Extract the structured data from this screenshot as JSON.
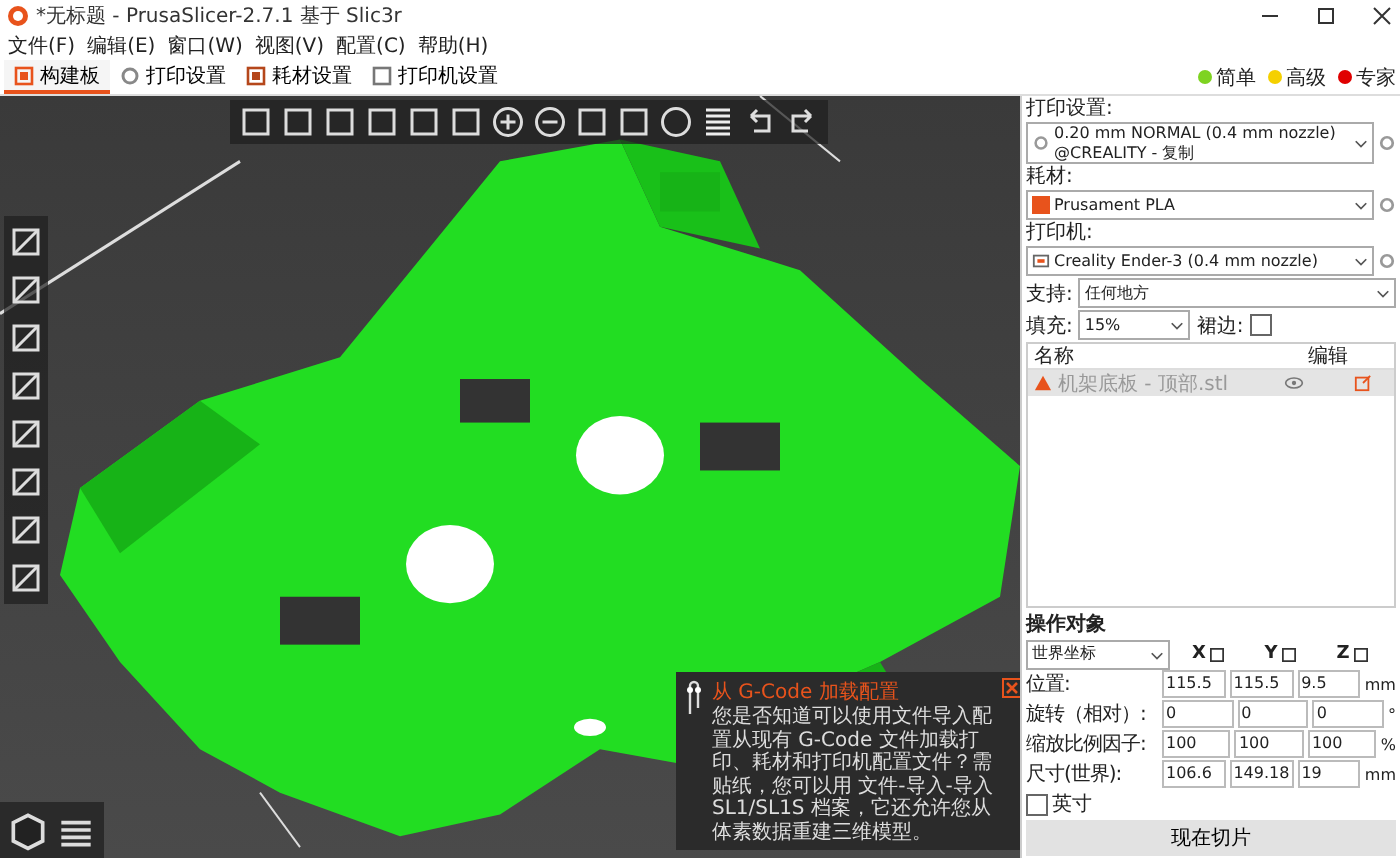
{
  "window": {
    "title": "*无标题 - PrusaSlicer-2.7.1 基于 Slic3r"
  },
  "menu": [
    "文件(F)",
    "编辑(E)",
    "窗口(W)",
    "视图(V)",
    "配置(C)",
    "帮助(H)"
  ],
  "tabs": [
    {
      "label": "构建板",
      "kind": "plater",
      "selected": true
    },
    {
      "label": "打印设置",
      "kind": "print",
      "selected": false
    },
    {
      "label": "耗材设置",
      "kind": "filament",
      "selected": false
    },
    {
      "label": "打印机设置",
      "kind": "printer",
      "selected": false
    }
  ],
  "modes": [
    {
      "label": "简单",
      "color": "#7ed321"
    },
    {
      "label": "高级",
      "color": "#f5d000"
    },
    {
      "label": "专家",
      "color": "#e00000"
    }
  ],
  "presets": [
    {
      "label": "打印设置:",
      "value": "0.20 mm NORMAL (0.4 mm nozzle) @CREALITY - 复制",
      "kind": "print"
    },
    {
      "label": "耗材:",
      "value": "Prusament PLA",
      "kind": "filament",
      "color": "#e8531c"
    },
    {
      "label": "打印机:",
      "value": "Creality Ender-3 (0.4 mm nozzle)",
      "kind": "printer"
    }
  ],
  "support": {
    "label": "支持:",
    "value": "任何地方"
  },
  "infill": {
    "label": "填充:",
    "value": "15%"
  },
  "brim": {
    "label": "裙边:",
    "checked": false
  },
  "object_list": {
    "columns": [
      "名称",
      "编辑"
    ],
    "rows": [
      {
        "name": "机架底板 - 顶部.stl",
        "warning": true,
        "selected": true
      }
    ]
  },
  "manipulation": {
    "title": "操作对象",
    "coordinates": "世界坐标",
    "axes": [
      "X",
      "Y",
      "Z"
    ],
    "rows": [
      {
        "label": "位置:",
        "values": [
          "115.5",
          "115.5",
          "9.5"
        ],
        "unit": "mm"
      },
      {
        "label": "旋转（相对）:",
        "values": [
          "0",
          "0",
          "0"
        ],
        "unit": "°"
      },
      {
        "label": "缩放比例因子:",
        "values": [
          "100",
          "100",
          "100"
        ],
        "unit": "%"
      },
      {
        "label": "尺寸(世界):",
        "values": [
          "106.6",
          "149.18",
          "19"
        ],
        "unit": "mm"
      }
    ],
    "inches": {
      "label": "英寸",
      "checked": false
    }
  },
  "slice_button": "现在切片",
  "notification": {
    "title": "从 G-Code 加载配置",
    "text": "您是否知道可以使用文件导入配置从现有 G-Code 文件加载打印、耗材和打印机配置文件？需贴纸，您可以用 文件-导入-导入 SL1/SL1S 档案，它还允许您从体素数据重建三维模型。"
  }
}
